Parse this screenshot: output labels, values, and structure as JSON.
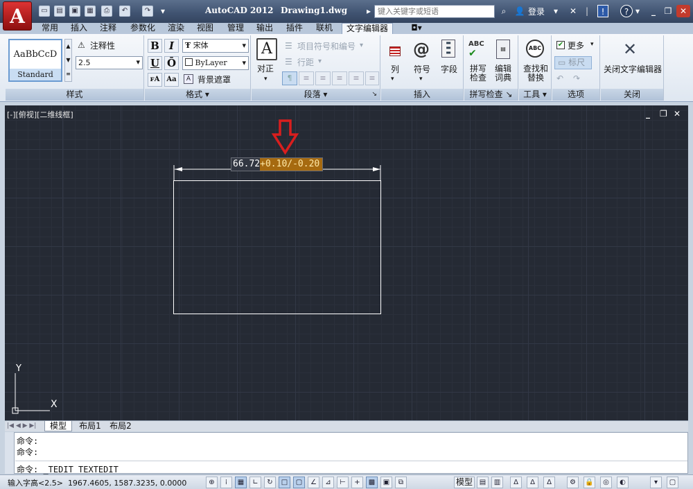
{
  "app": {
    "title": "AutoCAD 2012",
    "document": "Drawing1.dwg"
  },
  "title_bar": {
    "search_placeholder": "键入关键字或短语",
    "login_label": "登录",
    "help_label": "?"
  },
  "ribbon_tabs": [
    "常用",
    "插入",
    "注释",
    "参数化",
    "渲染",
    "视图",
    "管理",
    "输出",
    "插件",
    "联机",
    "文字编辑器"
  ],
  "active_tab": "文字编辑器",
  "ribbon": {
    "style": {
      "preview": "AaBbCcD",
      "style_name": "Standard",
      "annotative_label": "注释性",
      "height_value": "2.5",
      "panel_title": "样式"
    },
    "format": {
      "bold": "B",
      "italic": "I",
      "underline": "U",
      "overline": "Ō",
      "font_value": "宋体",
      "color_value": "ByLayer",
      "mask_label": "背景遮罩",
      "panel_title": "格式"
    },
    "paragraph": {
      "justify_label": "对正",
      "bullets_label": "项目符号和编号",
      "line_spacing_label": "行距",
      "panel_title": "段落"
    },
    "insert": {
      "columns_label": "列",
      "symbol_label": "符号",
      "field_label": "字段",
      "panel_title": "插入"
    },
    "spell": {
      "spell_check_label": "拼写检查",
      "edit_dict_label": "编辑词典",
      "panel_title": "拼写检查"
    },
    "tools": {
      "find_replace_label": "查找和替换",
      "panel_title": "工具"
    },
    "options": {
      "more_label": "更多",
      "ruler_label": "标尺",
      "panel_title": "选项"
    },
    "close": {
      "close_editor_label": "关闭文字编辑器",
      "panel_title": "关闭"
    }
  },
  "viewport": {
    "label": "[-][俯视][二维线框]",
    "dimension_value": "66.72",
    "tolerance_text": "+0.10/-0.20",
    "ucs_x": "X",
    "ucs_y": "Y"
  },
  "layout_tabs": [
    "模型",
    "布局1",
    "布局2"
  ],
  "command_line": {
    "line1": "命令:",
    "line2": "命令:",
    "current": "命令: _TEDIT TEXTEDIT"
  },
  "status_bar": {
    "prompt": "输入字高<2.5>",
    "coordinates": "1967.4605, 1587.3235, 0.0000",
    "model_label": "模型"
  },
  "colors": {
    "canvas_bg": "#252a34",
    "arrow": "#d91e1e",
    "tolerance_highlight": "#a66a10",
    "tolerance_text": "#ffe9a8"
  }
}
